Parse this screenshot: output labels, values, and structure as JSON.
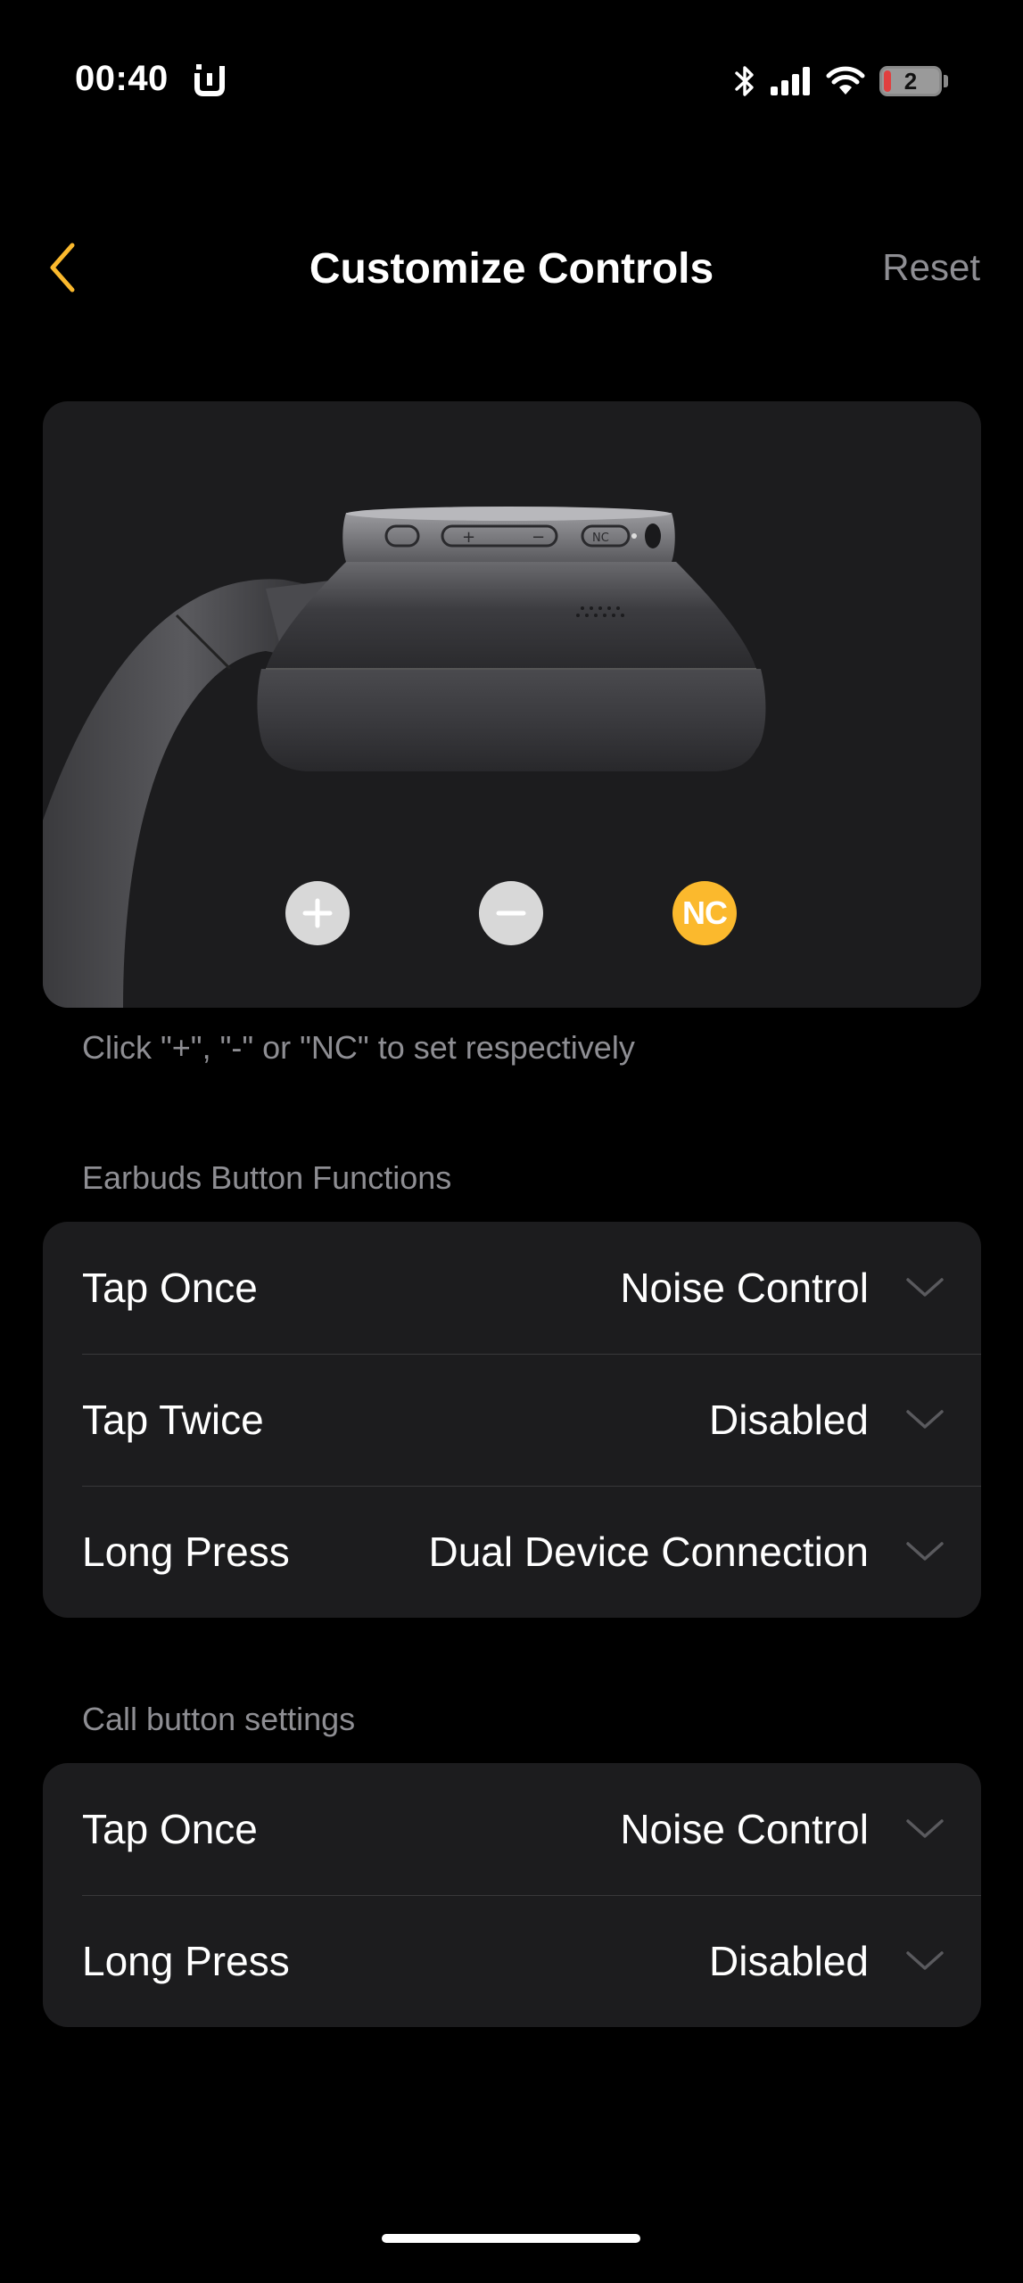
{
  "status_bar": {
    "time": "00:40",
    "battery_level": "2",
    "icons": [
      "app-u-icon",
      "bluetooth-icon",
      "cellular-signal-icon",
      "wifi-icon",
      "battery-icon"
    ]
  },
  "nav": {
    "title": "Customize Controls",
    "reset_label": "Reset",
    "back_icon": "chevron-left-icon"
  },
  "device_controls": {
    "buttons": [
      {
        "name": "plus",
        "icon": "plus-icon"
      },
      {
        "name": "minus",
        "icon": "minus-icon"
      },
      {
        "name": "nc",
        "label": "NC"
      }
    ],
    "hint": "Click \"+\", \"-\" or \"NC\" to set respectively"
  },
  "earbuds_section": {
    "header": "Earbuds Button Functions",
    "rows": [
      {
        "label": "Tap Once",
        "value": "Noise Control"
      },
      {
        "label": "Tap Twice",
        "value": "Disabled"
      },
      {
        "label": "Long Press",
        "value": "Dual Device Connection"
      }
    ]
  },
  "call_section": {
    "header": "Call button settings",
    "rows": [
      {
        "label": "Tap Once",
        "value": "Noise Control"
      },
      {
        "label": "Long Press",
        "value": "Disabled"
      }
    ]
  },
  "colors": {
    "background": "#000000",
    "card": "#1c1c1e",
    "accent": "#fbb92d",
    "secondary_text": "#8e8e93",
    "separator": "#38383a"
  }
}
